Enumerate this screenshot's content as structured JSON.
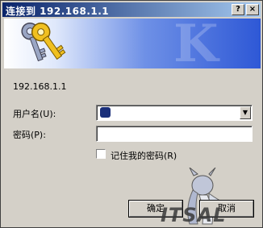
{
  "window": {
    "title": "连接到 192.168.1.1",
    "help_button": "?",
    "close_button": "×"
  },
  "banner": {
    "watermark": "K"
  },
  "site": {
    "label": "192.168.1.1"
  },
  "form": {
    "username_label": "用户名(U):",
    "password_label": "密码(P):",
    "username_value": "",
    "password_value": "",
    "remember_label": "记住我的密码(R)"
  },
  "buttons": {
    "ok": "确定",
    "cancel": "取消"
  },
  "watermark": {
    "text": "ITSAL"
  },
  "colors": {
    "titlebar_start": "#0a246a",
    "titlebar_end": "#a6caf0",
    "dialog_bg": "#d4d0c8"
  }
}
